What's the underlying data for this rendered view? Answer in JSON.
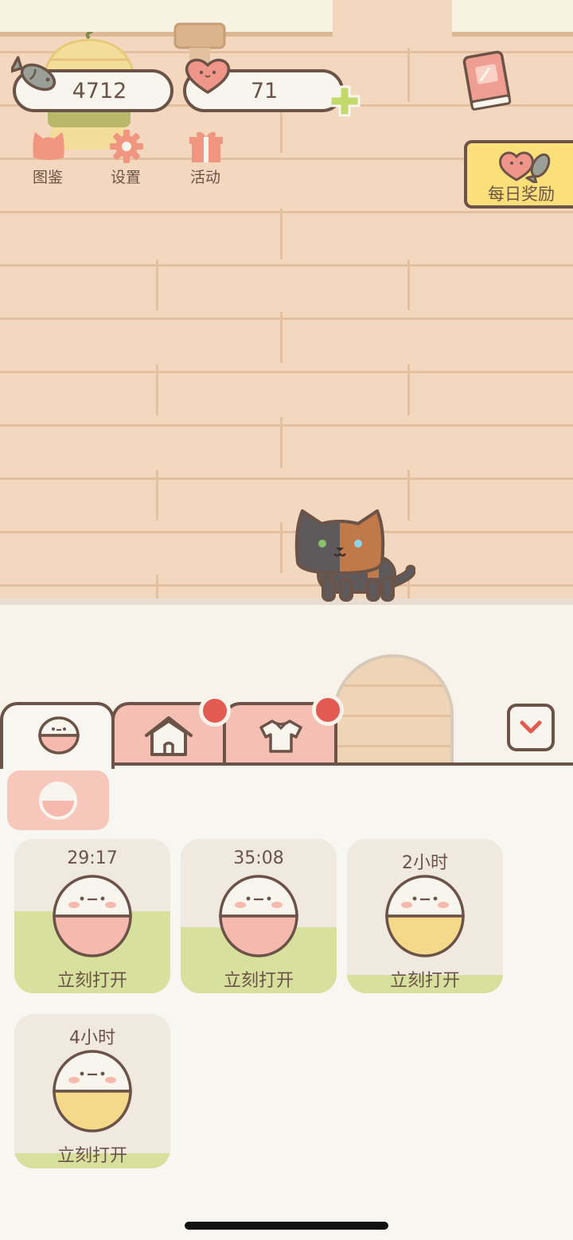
{
  "currency": {
    "fish": "4712",
    "hearts": "71"
  },
  "menu": {
    "collection_label": "图鉴",
    "settings_label": "设置",
    "events_label": "活动"
  },
  "daily_reward_label": "每日奖励",
  "tabs": {
    "home_badge": true,
    "clothes_badge": true
  },
  "capsules": [
    {
      "time": "29:17",
      "action": "立刻打开",
      "color": "pink",
      "progress": 0.53
    },
    {
      "time": "35:08",
      "action": "立刻打开",
      "color": "pink",
      "progress": 0.43
    },
    {
      "time": "2小时",
      "action": "立刻打开",
      "color": "yellow",
      "progress": 0.12
    },
    {
      "time": "4小时",
      "action": "立刻打开",
      "color": "yellow",
      "progress": 0.1
    }
  ],
  "colors": {
    "ink": "#6b5348",
    "pink_capsule": "#f5b9ad",
    "yellow_capsule": "#f5d98a",
    "progress_green": "#d8e09d",
    "tab_pink": "#f5c0b3",
    "badge_red": "#e35a52",
    "reward_yellow": "#fbe07a"
  }
}
